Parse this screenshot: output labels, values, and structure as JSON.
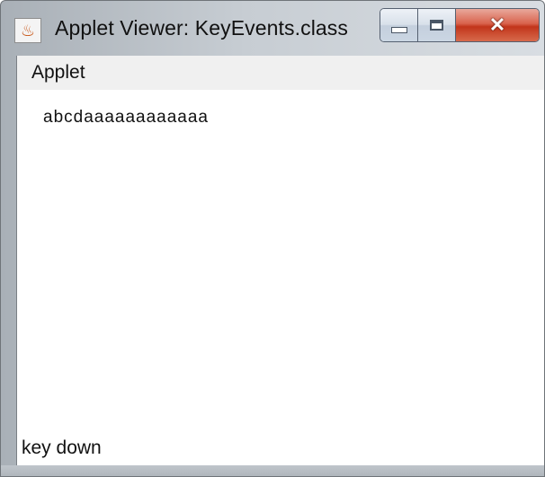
{
  "window": {
    "title": "Applet Viewer: KeyEvents.class",
    "app_icon": "java-icon",
    "controls": {
      "minimize": "minimize-icon",
      "maximize": "maximize-icon",
      "close": "close-icon"
    }
  },
  "menubar": {
    "items": [
      "Applet"
    ]
  },
  "applet": {
    "typed_text": "abcdaaaaaaaaaaaa"
  },
  "status_bar": {
    "text": "key down"
  },
  "colors": {
    "frame": "#c7cdd3",
    "close_button": "#c2351b",
    "menubar_bg": "#f0f0f0",
    "client_bg": "#ffffff"
  }
}
